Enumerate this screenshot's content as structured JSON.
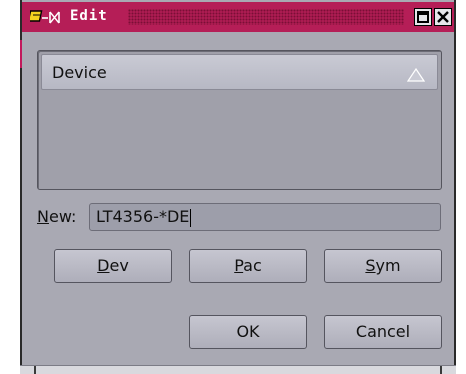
{
  "window": {
    "title": "Edit",
    "controls": [
      "maximize-icon",
      "close-icon"
    ],
    "accent_color": "#b51e57"
  },
  "list": {
    "column_header": "Device",
    "sort_icon": "sort-triangle-icon",
    "rows": []
  },
  "new_field": {
    "label_mnemonic": "N",
    "label_rest": "ew:",
    "value": "LT4356-*DE"
  },
  "buttons": {
    "dev": {
      "mnemonic": "D",
      "rest": "ev"
    },
    "pac": {
      "mnemonic": "P",
      "rest": "ac"
    },
    "sym": {
      "mnemonic": "S",
      "rest": "ym"
    },
    "ok": "OK",
    "cancel": "Cancel"
  }
}
